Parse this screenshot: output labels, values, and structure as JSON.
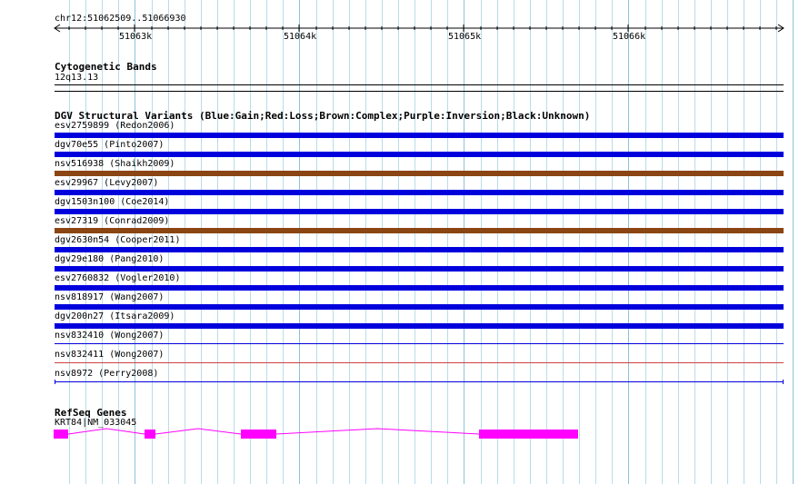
{
  "ruler": {
    "location": "chr12:51062509..51066930",
    "ticks": [
      "51063k",
      "51064k",
      "51065k",
      "51066k"
    ]
  },
  "cytoband": {
    "title": "Cytogenetic Bands",
    "band": "12q13.13"
  },
  "dgv": {
    "title": "DGV Structural Variants (Blue:Gain;Red:Loss;Brown:Complex;Purple:Inversion;Black:Unknown)",
    "colors": {
      "gain": "#0000dd",
      "loss": "#d04040",
      "complex": "#8b4513"
    },
    "variants": [
      {
        "label": "esv2759899 (Redon2006)",
        "type": "gain",
        "style": "thick"
      },
      {
        "label": "dgv70e55 (Pinto2007)",
        "type": "gain",
        "style": "thick"
      },
      {
        "label": "nsv516938 (Shaikh2009)",
        "type": "complex",
        "style": "thick"
      },
      {
        "label": "esv29967 (Levy2007)",
        "type": "gain",
        "style": "thick"
      },
      {
        "label": "dgv1503n100 (Coe2014)",
        "type": "gain",
        "style": "thick"
      },
      {
        "label": "esv27319 (Conrad2009)",
        "type": "complex",
        "style": "thick"
      },
      {
        "label": "dgv2630n54 (Cooper2011)",
        "type": "gain",
        "style": "thick"
      },
      {
        "label": "dgv29e180 (Pang2010)",
        "type": "gain",
        "style": "thick"
      },
      {
        "label": "esv2760832 (Vogler2010)",
        "type": "gain",
        "style": "thick"
      },
      {
        "label": "nsv818917 (Wang2007)",
        "type": "gain",
        "style": "thick"
      },
      {
        "label": "dgv200n27 (Itsara2009)",
        "type": "gain",
        "style": "thick"
      },
      {
        "label": "nsv832410 (Wong2007)",
        "type": "gain",
        "style": "thin"
      },
      {
        "label": "nsv832411 (Wong2007)",
        "type": "loss",
        "style": "thin"
      },
      {
        "label": "nsv8972 (Perry2008)",
        "type": "gain",
        "style": "bracket"
      }
    ]
  },
  "refseq": {
    "title": "RefSeq Genes",
    "gene_label": "KRT84|NM_033045",
    "color": "#ff00ff"
  }
}
